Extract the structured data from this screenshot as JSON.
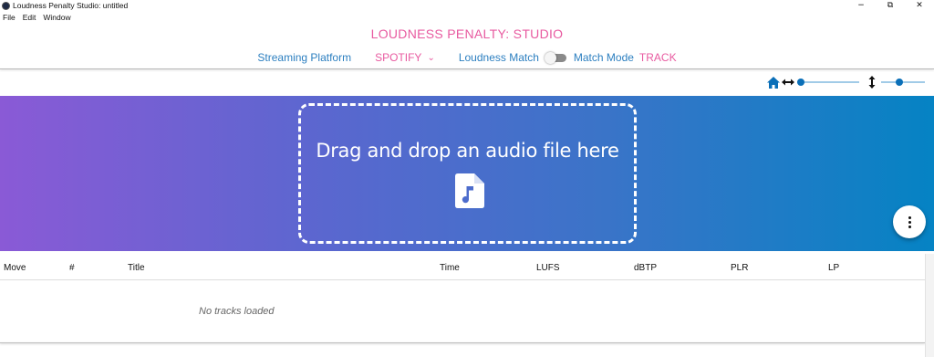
{
  "window": {
    "title": "Loudness Penalty Studio: untitled",
    "controls": {
      "minimize": "−",
      "restore": "⧉",
      "close": "✕"
    }
  },
  "menu": {
    "items": [
      "File",
      "Edit",
      "Window"
    ]
  },
  "header": {
    "app_title": "LOUDNESS PENALTY: STUDIO",
    "streaming_platform_label": "Streaming Platform",
    "streaming_platform_value": "SPOTIFY",
    "loudness_match_label": "Loudness Match",
    "loudness_match_on": false,
    "match_mode_label": "Match Mode",
    "match_mode_value": "TRACK"
  },
  "zoom": {
    "home_icon": "home-icon",
    "horizontal_icon": "horizontal-arrows-icon",
    "horizontal_level": 0.0,
    "vertical_icon": "vertical-arrows-icon",
    "vertical_level": 0.4
  },
  "dropzone": {
    "text": "Drag and drop an audio file here",
    "icon": "audio-file-icon",
    "gradient_start": "#8a5ad6",
    "gradient_end": "#0583c4"
  },
  "table": {
    "columns": [
      "Move",
      "#",
      "Title",
      "Time",
      "LUFS",
      "dBTP",
      "PLR",
      "LP"
    ],
    "empty_message": "No tracks loaded"
  },
  "colors": {
    "accent_pink": "#e85aa0",
    "accent_blue": "#2c7fc0"
  }
}
